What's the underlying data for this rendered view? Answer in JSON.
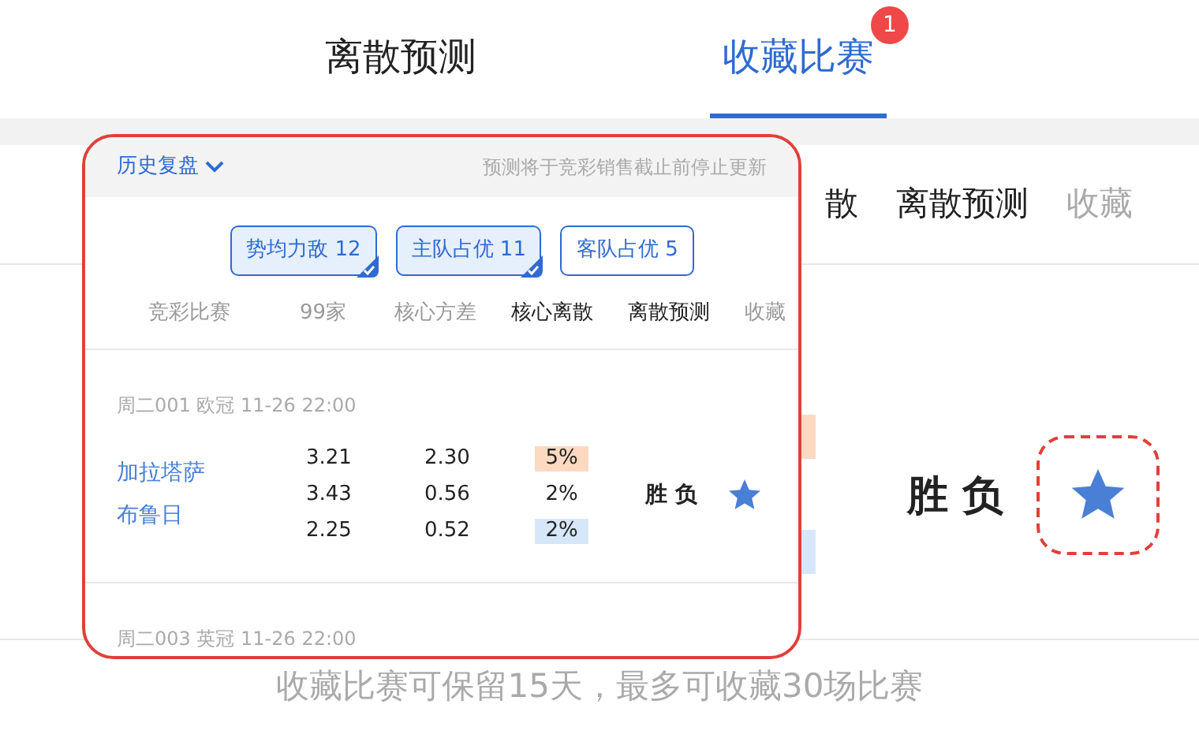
{
  "tabs": [
    {
      "label": "离散预测",
      "selected": false
    },
    {
      "label": "收藏比赛",
      "selected": true,
      "badge": "1"
    }
  ],
  "background": {
    "columns": [
      {
        "label": "散",
        "muted": false
      },
      {
        "label": "离散预测",
        "muted": false
      },
      {
        "label": "收藏",
        "muted": true
      }
    ],
    "prediction": "胜 负",
    "favorited": true
  },
  "inset": {
    "history_label": "历史复盘",
    "notice": "预测将于竞彩销售截止前停止更新",
    "filters": [
      {
        "label": "势均力敌",
        "count": "12",
        "selected": true
      },
      {
        "label": "主队占优",
        "count": "11",
        "selected": true
      },
      {
        "label": "客队占优",
        "count": "5",
        "selected": false
      }
    ],
    "columns": [
      {
        "label": "竞彩比赛",
        "muted": true
      },
      {
        "label": "99家",
        "muted": true
      },
      {
        "label": "核心方差",
        "muted": true
      },
      {
        "label": "核心离散",
        "muted": false
      },
      {
        "label": "离散预测",
        "muted": false
      },
      {
        "label": "收藏",
        "muted": true
      }
    ],
    "matches": [
      {
        "meta": "周二001 欧冠 11-26 22:00",
        "home": "加拉塔萨",
        "away": "布鲁日",
        "rows": [
          {
            "odds": "3.21",
            "variance": "2.30",
            "dispersion": "5%",
            "color": "#fcd9c0"
          },
          {
            "odds": "3.43",
            "variance": "0.56",
            "dispersion": "2%"
          },
          {
            "odds": "2.25",
            "variance": "0.52",
            "dispersion": "2%",
            "color": "#d7e7fa"
          }
        ],
        "prediction": "胜 负",
        "favorited": true
      },
      {
        "meta": "周二003 英冠 11-26 22:00"
      }
    ]
  },
  "footer": "收藏比赛可保留15天，最多可收藏30场比赛"
}
